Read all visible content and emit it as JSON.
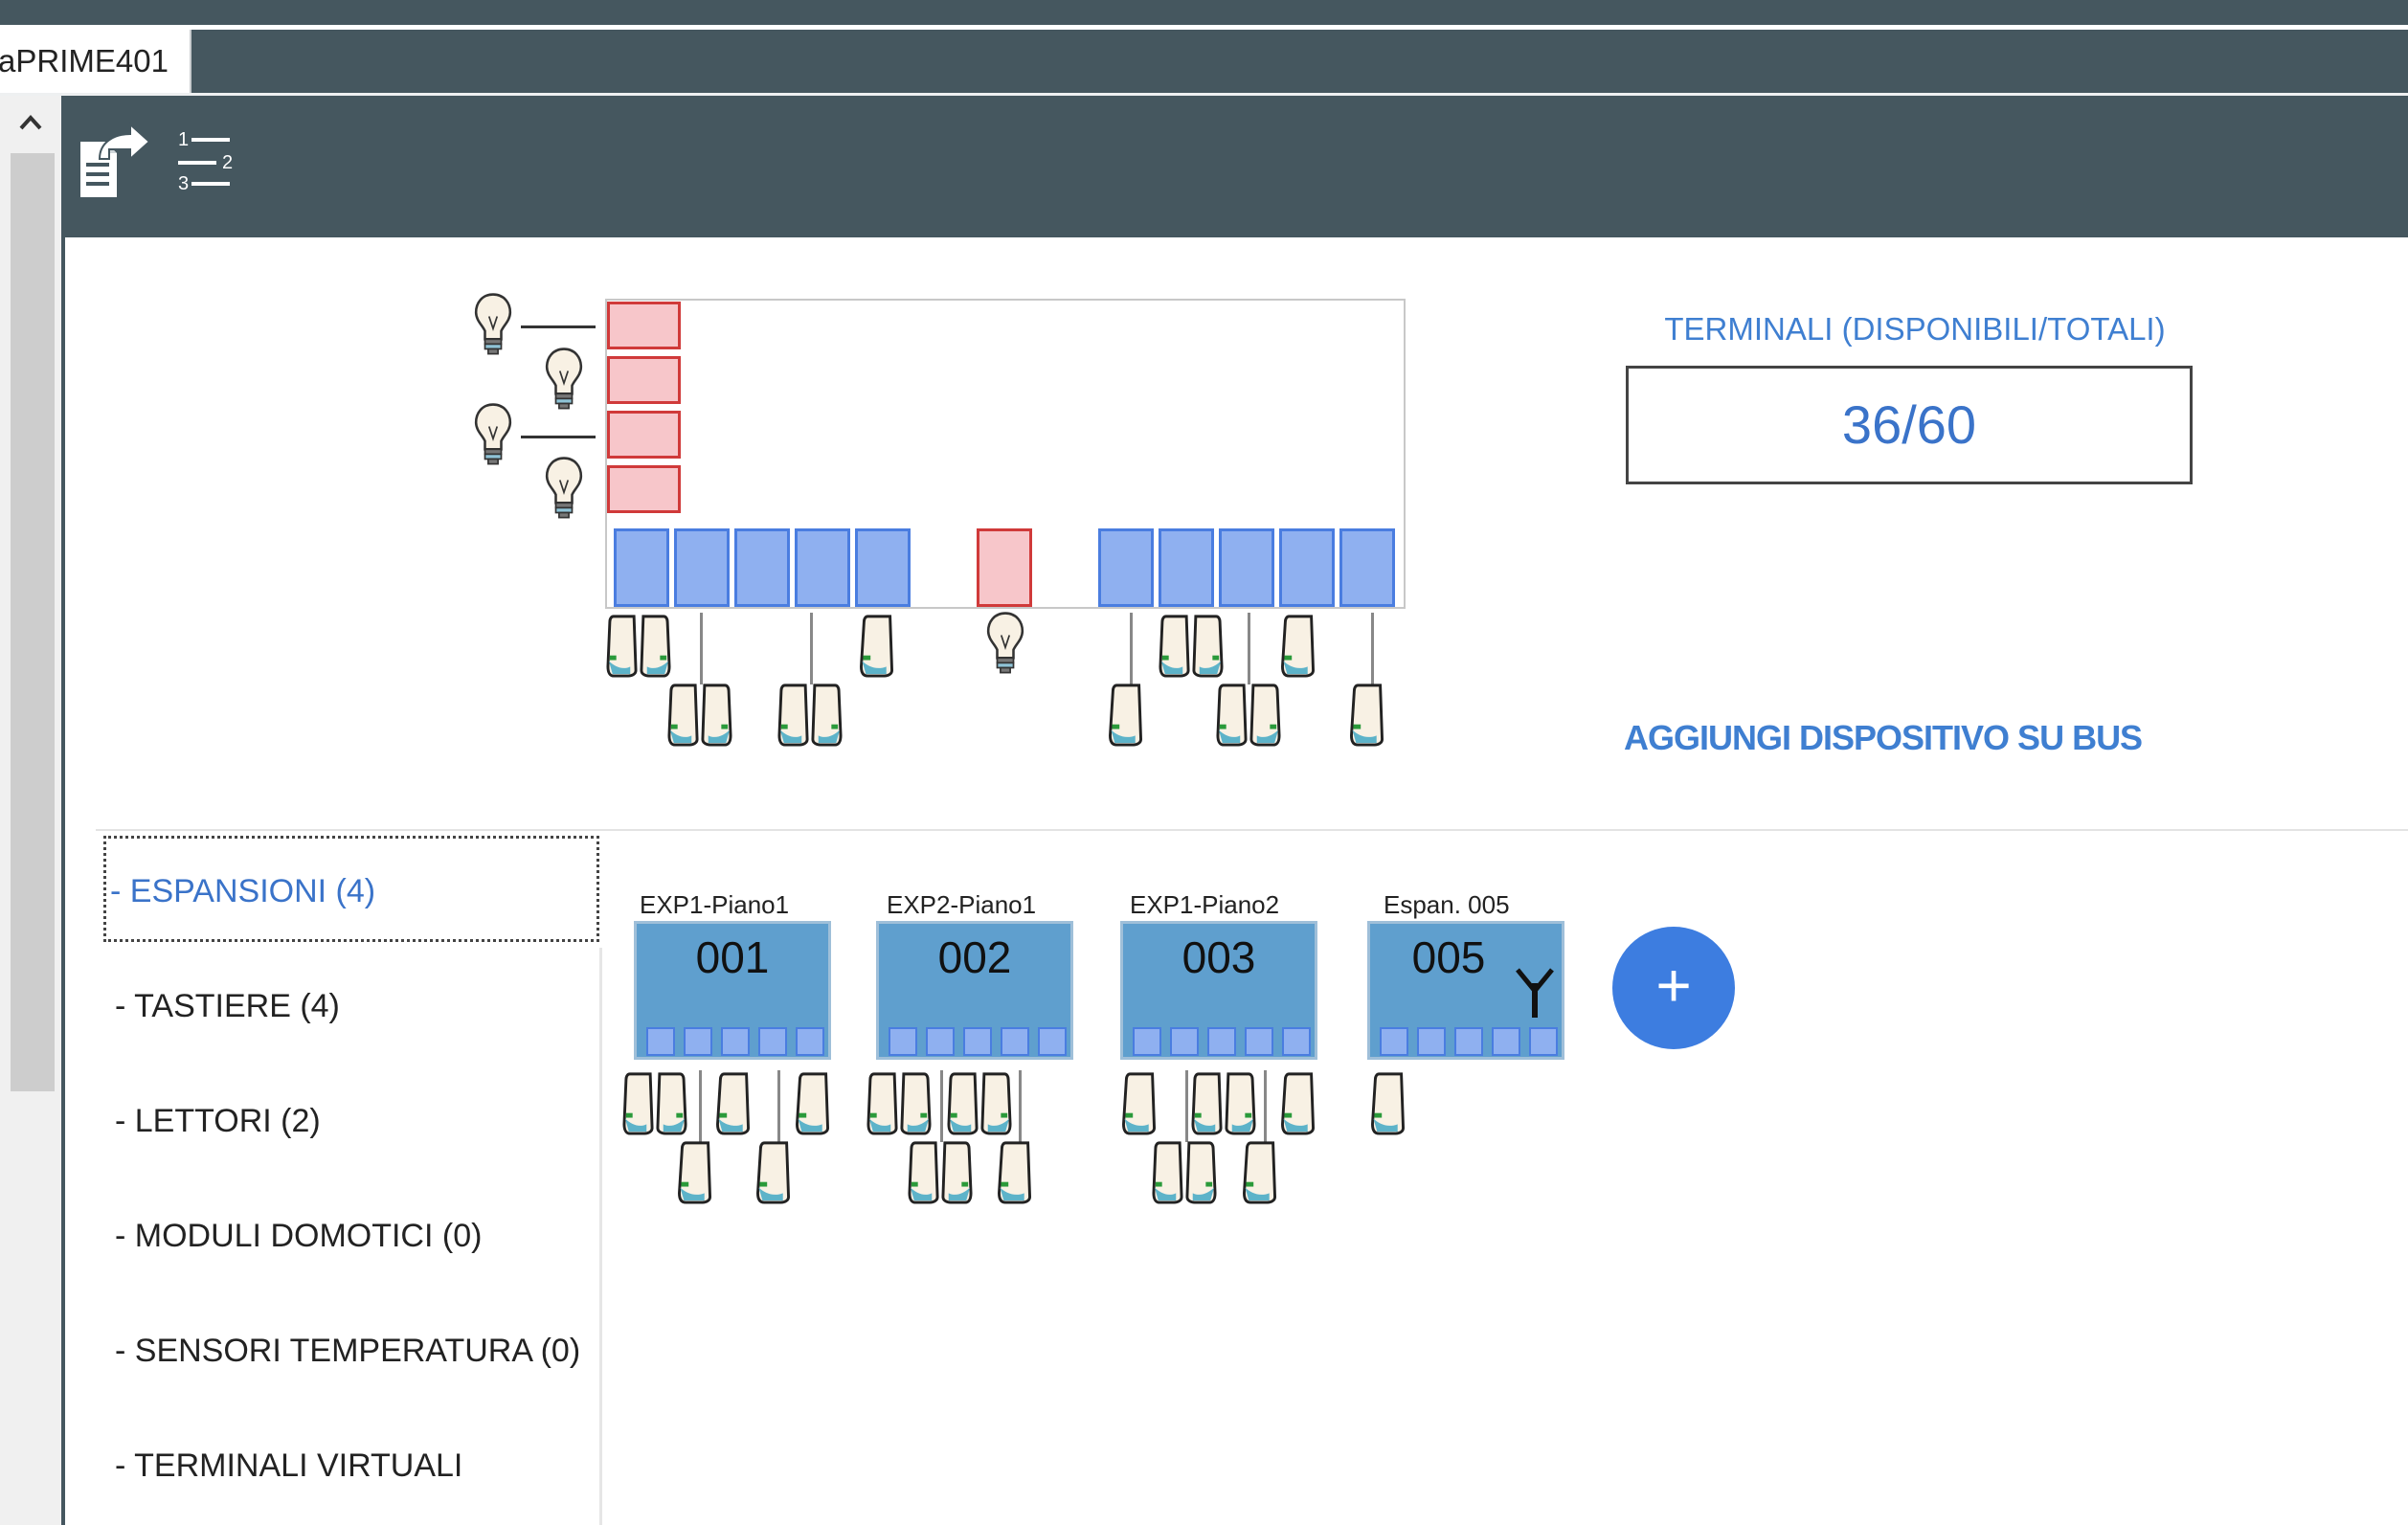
{
  "tab": {
    "label": "aPRIME401"
  },
  "scrollbar": {
    "up_arrow": "^"
  },
  "toolbar": {
    "export_icon": "document-export-icon",
    "list_icon": "numbered-list-icon"
  },
  "terminals": {
    "title": "TERMINALI (DISPONIBILI/TOTALI)",
    "value": "36/60"
  },
  "add_bus_device": "AGGIUNGI DISPOSITIVO SU BUS",
  "categories": [
    {
      "label": "- ESPANSIONI (4)"
    },
    {
      "label": "- TASTIERE (4)"
    },
    {
      "label": "- LETTORI (2)"
    },
    {
      "label": "- MODULI DOMOTICI (0)"
    },
    {
      "label": "- SENSORI TEMPERATURA (0)"
    },
    {
      "label": "- TERMINALI VIRTUALI"
    }
  ],
  "expansions": [
    {
      "name": "EXP1-Piano1",
      "number": "001"
    },
    {
      "name": "EXP2-Piano1",
      "number": "002"
    },
    {
      "name": "EXP1-Piano2",
      "number": "003"
    },
    {
      "name": "Espan. 005",
      "number": "005",
      "icon": "antenna-icon"
    }
  ],
  "add_expansion": "+",
  "colors": {
    "chrome": "#45575f",
    "accent": "#3d7de0",
    "relay": "#f7c6ca",
    "terminal": "#8fb0f0",
    "module": "#5f9fce"
  }
}
